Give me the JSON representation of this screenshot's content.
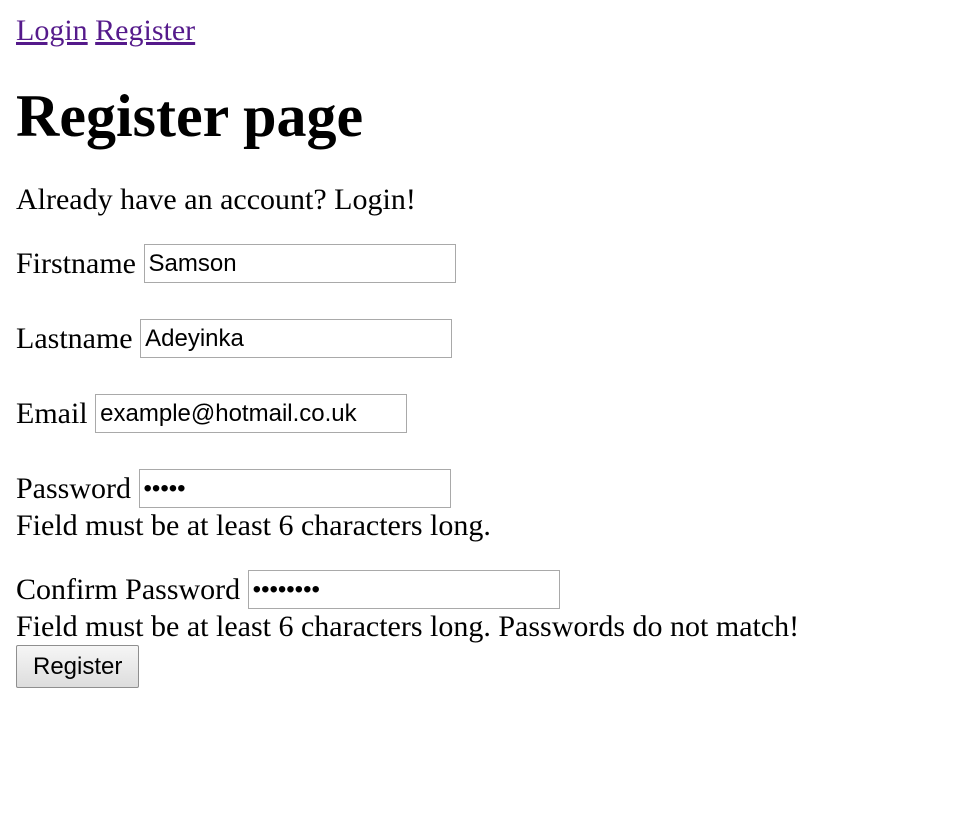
{
  "nav": {
    "login_label": "Login",
    "register_label": "Register"
  },
  "page_title": "Register page",
  "intro_text": "Already have an account? Login!",
  "form": {
    "firstname": {
      "label": "Firstname",
      "value": "Samson"
    },
    "lastname": {
      "label": "Lastname",
      "value": "Adeyinka"
    },
    "email": {
      "label": "Email",
      "value": "example@hotmail.co.uk"
    },
    "password": {
      "label": "Password",
      "value": "•••••",
      "error": "Field must be at least 6 characters long."
    },
    "confirm_password": {
      "label": "Confirm Password",
      "value": "••••••••",
      "error": "Field must be at least 6 characters long. Passwords do not match!"
    },
    "submit_label": "Register"
  }
}
